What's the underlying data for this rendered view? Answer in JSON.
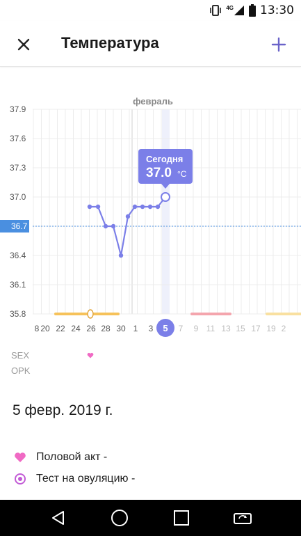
{
  "status_bar": {
    "time": "13:30",
    "network": "4G",
    "icons": [
      "vibrate-icon",
      "signal-icon",
      "battery-icon"
    ]
  },
  "toolbar": {
    "title": "Температура",
    "close_icon": "close-icon",
    "add_icon": "add-icon"
  },
  "colors": {
    "accent": "#7b7fe8",
    "sex_pink": "#f06ac4",
    "ovulation_purple": "#c25bd6",
    "period_orange": "#f6c25a",
    "period_red": "#f4a5ad",
    "cover_line": "#4a8fe0"
  },
  "chart_data": {
    "type": "line",
    "title": "февраль",
    "ylim": [
      35.8,
      37.9
    ],
    "yticks": [
      "37.9",
      "37.6",
      "37.3",
      "37.0",
      "36.7",
      "36.4",
      "36.1",
      "35.8"
    ],
    "cover_line": {
      "value": 36.7,
      "label": "36.7"
    },
    "x_labels": [
      "8",
      "20",
      "22",
      "24",
      "26",
      "28",
      "30",
      "1",
      "3",
      "5",
      "7",
      "9",
      "11",
      "13",
      "15",
      "17",
      "19",
      "2"
    ],
    "today_label": "5",
    "tooltip": {
      "title": "Сегодня",
      "value": "37.0",
      "unit": "°C"
    },
    "series": [
      {
        "values": [
          36.9,
          36.9,
          36.7,
          36.7,
          36.4,
          36.8,
          36.9,
          36.9,
          36.9,
          36.9,
          37.0
        ]
      }
    ]
  },
  "rows": {
    "sex": "SEX",
    "opk": "OPK"
  },
  "selected_date": "5 февр. 2019 г.",
  "legend": [
    {
      "icon": "heart-icon",
      "label": "Половой акт -"
    },
    {
      "icon": "ovulation-test-icon",
      "label": "Тест на овуляцию -"
    }
  ],
  "nav": [
    "back-icon",
    "home-icon",
    "recents-icon",
    "rotate-screen-icon"
  ]
}
